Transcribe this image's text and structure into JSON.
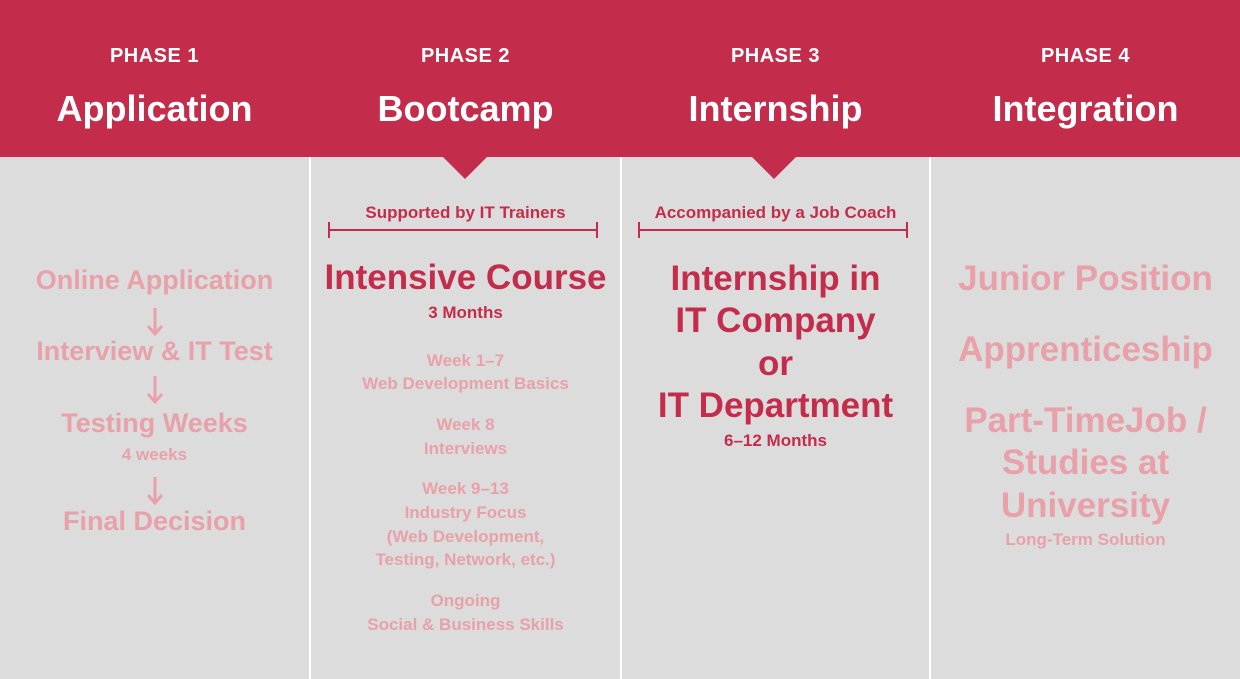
{
  "phases": [
    {
      "phase_label": "PHASE 1",
      "title": "Application",
      "steps": [
        "Online Application",
        "Interview & IT Test",
        "Testing Weeks",
        "Final Decision"
      ],
      "testing_duration": "4 weeks"
    },
    {
      "phase_label": "PHASE 2",
      "title": "Bootcamp",
      "support": "Supported by IT Trainers",
      "main": "Intensive Course",
      "duration": "3 Months",
      "schedule": [
        {
          "period": "Week 1–7",
          "topic": "Web Development Basics"
        },
        {
          "period": "Week 8",
          "topic": "Interviews"
        },
        {
          "period": "Week 9–13",
          "topic": "Industry Focus",
          "detail1": "(Web Development,",
          "detail2": "Testing, Network, etc.)"
        },
        {
          "period": "Ongoing",
          "topic": "Social & Business Skills"
        }
      ]
    },
    {
      "phase_label": "PHASE 3",
      "title": "Internship",
      "support": "Accompanied by a Job Coach",
      "main_lines": [
        "Internship in",
        "IT Company",
        "or",
        "IT Department"
      ],
      "duration": "6–12 Months"
    },
    {
      "phase_label": "PHASE 4",
      "title": "Integration",
      "outcomes": [
        "Junior Position",
        "Apprenticeship"
      ],
      "outcome3_lines": [
        "Part-TimeJob /",
        "Studies at",
        "University"
      ],
      "outcome3_note": "Long-Term Solution"
    }
  ],
  "colors": {
    "header": "#c42c4b",
    "background": "#dcdcdc",
    "accent_text": "#c42c4b",
    "muted_text": "#e8a1a8",
    "divider": "#ffffff"
  }
}
